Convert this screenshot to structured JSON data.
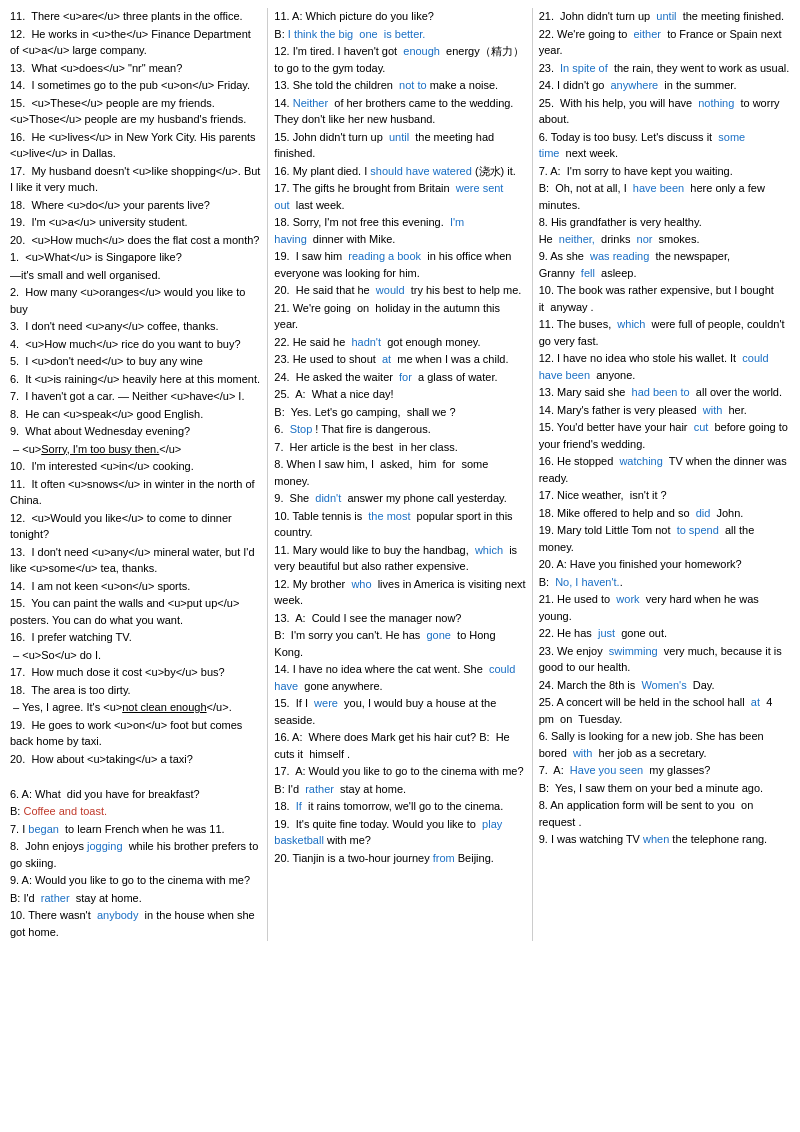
{
  "col1": [
    "11.  There <u>are</u> three plants in the office.",
    "12.  He works in <u>the</u> Finance Department of <u>a</u> large company.",
    "13.  What <u>does</u> \"nr\" mean?",
    "14.  I sometimes go to the pub  <u>on</u>  Friday.",
    "15.  <u>These</u> people are my friends. <u>Those</u> people are my husband's friends.",
    "16.  He <u>lives</u> in New York City. His parents <u>live</u> in Dallas.",
    "17.  My husband doesn't <u>like shopping</u>. But I like it very much.",
    "18.  Where <u>do</u> your parents live?",
    "19.  I'm <u>a</u> university student.",
    "20.  <u>How much</u> does the flat cost a month?",
    "1.  <u>What</u> is Singapore like?",
    "—it's small and well organised.",
    "2.  How many <u>oranges</u> would you like to buy",
    "3.  I don't need <u>any</u> coffee, thanks.",
    "4.  <u>How much</u> rice do you want to buy?",
    "5.  I <u>don't need</u>  to buy any wine",
    "6.  It <u>is raining</u> heavily here at this moment.",
    "7.  I haven't got a car. — Neither <u>have</u> I.",
    "8.  He can <u>speak</u> good English.",
    "9.  What about Wednesday evening?",
    " – <u>Sorry, I'm too busy then.</u>",
    "10.  I'm interested <u>in</u> cooking.",
    "11.  It often <u>snows</u> in winter in the north of China.",
    "12.  <u>Would you like</u> to come to dinner tonight?",
    "13.  I don't need <u>any</u> mineral water, but I'd like <u>some</u> tea, thanks.",
    "14.  I am not keen <u>on</u> sports.",
    "15.  You can paint the walls and <u>put up</u> posters. You can do what you want.",
    "16.  I prefer watching TV.",
    " – <u>So</u> do I.",
    "17.  How much dose it cost <u>by</u> bus?",
    "18.  The area is too dirty.",
    " – Yes, I agree. It's <u>not clean enough</u>.",
    "19.  He goes to work <u>on</u> foot but comes back home by taxi.",
    "20.  How about <u>taking</u> a taxi?",
    "",
    "6. A: What  did you have for breakfast?",
    "B: Coffee and toast.",
    "7. I  began  to learn French when he was 11.",
    "8.  John enjoys  jogging  while his brother prefers to go skiing.",
    "9. A: Would you like to go to the cinema with me?",
    "B: I'd  rather  stay at home.",
    "10. There wasn't  anybody  in the house when she got home."
  ],
  "col2": [
    "11. A: Which picture do you like?",
    "B: I think the big  one  is better.",
    "12. I'm tired. I haven't got  enough  energy（精力）to go to the gym today.",
    "13. She told the children  not to make a noise.",
    "14. Neither  of her brothers came to the wedding. They don't like her new husband.",
    "15. John didn't turn up  until  the meeting had finished.",
    "16. My plant died. I should have watered (浇水) it.",
    "17. The gifts he brought from Britain  were sent out  last week.",
    "18. Sorry, I'm not free this evening.  I'm having  dinner with Mike.",
    "19.  I saw him  reading a book  in his office when everyone was looking for him.",
    "20.  He said that he  would  try his best to help me.",
    "21. We're going  on  holiday in the autumn this year.",
    "22. He said he  hadn't  got enough money.",
    "23. He used to shout  at  me when I was a child.",
    "24.  He asked the waiter  for  a glass of water.",
    "25.  A:  What a nice day!",
    "B:  Yes. Let's go camping,  shall we ?",
    "6.  Stop ! That fire is dangerous.",
    "7.  Her article is the best  in her class.",
    "8. When I saw him, I  asked,  him  for  some money.",
    "9.  She  didn't  answer my phone call yesterday.",
    "10. Table tennis is  the most  popular sport in this country.",
    "11. Mary would like to buy the handbag,  which  is very beautiful but also rather expensive.",
    "12. My brother  who  lives in America is visiting next week.",
    "13.  A:  Could I see the manager now?",
    "B:  I'm sorry you can't. He has  gone  to Hong Kong.",
    "14. I have no idea where the cat went. She  could have  gone anywhere.",
    "15.  If I  were  you, I would buy a house at the seaside.",
    "16. A:  Where does Mark get his hair cut? B:  He cuts it  himself .",
    "17.  A: Would you like to go to the cinema with me?",
    "B: I'd  rather  stay at home.",
    "18.  If  it rains tomorrow, we'll go to the cinema.",
    "19.  It's quite fine today. Would you like to  play basketball with me?",
    "20. Tianjin is a two-hour journey from Beijing."
  ],
  "col3": [
    "21.  John didn't turn up  until  the meeting finished.",
    "22. We're going to  either  to France or Spain next year.",
    "23.  In spite of  the rain, they went to work as usual.",
    "24. I didn't go  anywhere  in the summer.",
    "25.  With his help, you will have  nothing  to worry about.",
    "6. Today is too busy. Let's discuss it  some time  next week.",
    "7. A:  I'm sorry to have kept you waiting.",
    "B:  Oh, not at all, I  have been  here only a few minutes.",
    "8. His grandfather is very healthy. He  neither,  drinks  nor  smokes.",
    "9. As she  was reading  the newspaper, Granny  fell  asleep.",
    "10. The book was rather expensive, but I bought it  anyway .",
    "11. The buses,  which  were full of people, couldn't go very fast.",
    "12. I have no idea who stole his wallet. It  could have been  anyone.",
    "13. Mary said she  had been to  all over the world.",
    "14. Mary's father is very pleased  with  her.",
    "15. You'd better have your hair  cut  before going to your friend's wedding.",
    "16. He stopped  watching  TV when the dinner was ready.",
    "17. Nice weather,  isn't it ?",
    "18. Mike offered to help and so  did  John.",
    "19. Mary told Little Tom not  to spend  all the money.",
    "20. A: Have you finished your homework?",
    "B:  No, I haven't..",
    "21. He used to  work  very hard when he was young.",
    "22. He has  just  gone out.",
    "23. We enjoy  swimming  very much, because it is good to our health.",
    "24. March the 8th is  Women's  Day.",
    "25. A concert will be held in the school hall  at  4 pm  on  Tuesday.",
    "6. Sally is looking for a new job. She has been bored  with  her job as a secretary.",
    "7.  A:  Have you seen  my glasses?",
    "B:  Yes, I saw them on your bed a minute ago.",
    "8. An application form will be sent to you  on request .",
    "9. I was watching TV when the telephone rang."
  ]
}
